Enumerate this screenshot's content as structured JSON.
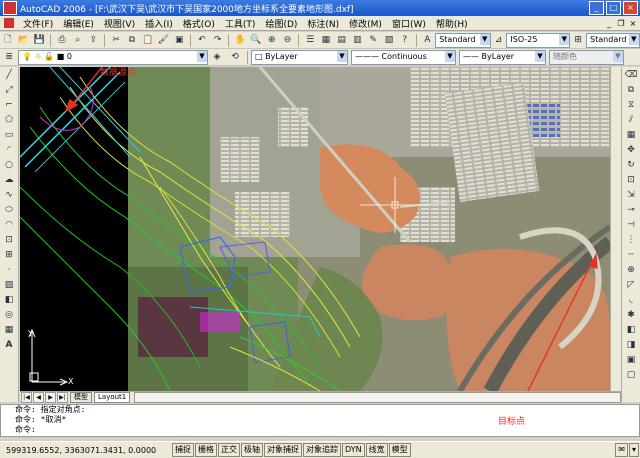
{
  "window": {
    "title": "AutoCAD 2006 - [F:\\武汉下吴\\武汉市下吴国家2000地方坐标系全要素地形图.dxf]"
  },
  "menu": [
    "文件(F)",
    "编辑(E)",
    "视图(V)",
    "插入(I)",
    "格式(O)",
    "工具(T)",
    "绘图(D)",
    "标注(N)",
    "修改(M)",
    "窗口(W)",
    "帮助(H)"
  ],
  "styles": {
    "text_style": "Standard",
    "dim_style": "ISO-25",
    "table_style": "Standard"
  },
  "layer": {
    "current": "0"
  },
  "properties": {
    "color": "ByLayer",
    "linetype": "Continuous",
    "lineweight": "ByLayer",
    "plotstyle": "随颜色"
  },
  "annotations": {
    "source_point": "数据源点",
    "target_point": "目标点"
  },
  "ucs": {
    "x": "X",
    "y": "Y"
  },
  "tabs": [
    "模型",
    "Layout1"
  ],
  "command": {
    "lines": [
      "命令: 指定对角点:",
      "命令: *取消*",
      "命令:"
    ]
  },
  "status": {
    "coordinates": "599319.6552, 3363071.3431, 0.0000",
    "toggles": [
      "捕捉",
      "栅格",
      "正交",
      "极轴",
      "对象捕捉",
      "对象追踪",
      "DYN",
      "线宽",
      "模型"
    ]
  },
  "colors": {
    "titlebar": "#1a56c8",
    "annotation": "#e8302a"
  }
}
